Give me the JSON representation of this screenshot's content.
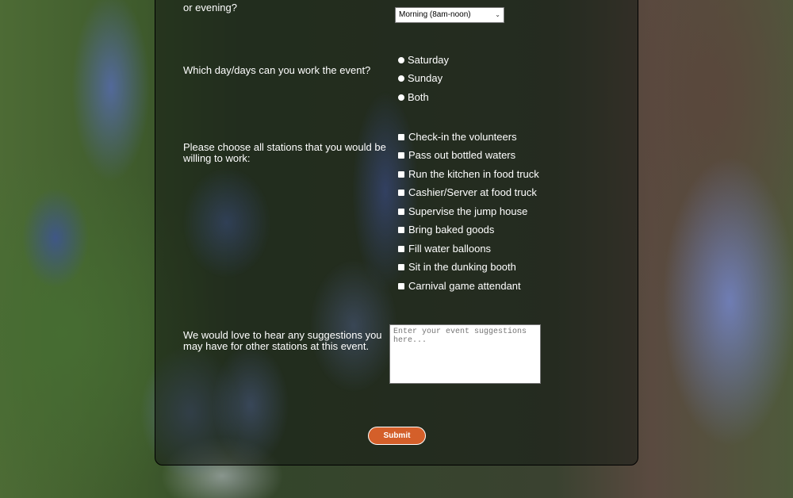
{
  "form": {
    "time_question_tail": "or evening?",
    "time_select_value": "Morning (8am-noon)",
    "day_question": "Which day/days can you work the event?",
    "day_options": [
      "Saturday",
      "Sunday",
      "Both"
    ],
    "station_question_line1": "Please choose all stations that you would be",
    "station_question_line2": "willing to work:",
    "station_options": [
      "Check-in the volunteers",
      "Pass out bottled waters",
      "Run the kitchen in food truck",
      "Cashier/Server at food truck",
      "Supervise the jump house",
      "Bring baked goods",
      "Fill water balloons",
      "Sit in the dunking booth",
      "Carnival game attendant"
    ],
    "suggest_line1": "We would love to hear any suggestions you",
    "suggest_line2": "may have for other stations at this event.",
    "suggest_placeholder": "Enter your event suggestions here...",
    "submit_label": "Submit"
  }
}
